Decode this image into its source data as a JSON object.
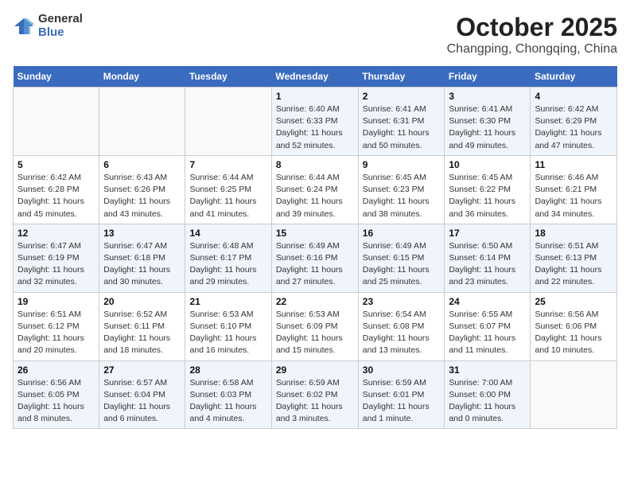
{
  "header": {
    "logo_general": "General",
    "logo_blue": "Blue",
    "title": "October 2025",
    "subtitle": "Changping, Chongqing, China"
  },
  "weekdays": [
    "Sunday",
    "Monday",
    "Tuesday",
    "Wednesday",
    "Thursday",
    "Friday",
    "Saturday"
  ],
  "weeks": [
    [
      {
        "day": "",
        "info": ""
      },
      {
        "day": "",
        "info": ""
      },
      {
        "day": "",
        "info": ""
      },
      {
        "day": "1",
        "info": "Sunrise: 6:40 AM\nSunset: 6:33 PM\nDaylight: 11 hours\nand 52 minutes."
      },
      {
        "day": "2",
        "info": "Sunrise: 6:41 AM\nSunset: 6:31 PM\nDaylight: 11 hours\nand 50 minutes."
      },
      {
        "day": "3",
        "info": "Sunrise: 6:41 AM\nSunset: 6:30 PM\nDaylight: 11 hours\nand 49 minutes."
      },
      {
        "day": "4",
        "info": "Sunrise: 6:42 AM\nSunset: 6:29 PM\nDaylight: 11 hours\nand 47 minutes."
      }
    ],
    [
      {
        "day": "5",
        "info": "Sunrise: 6:42 AM\nSunset: 6:28 PM\nDaylight: 11 hours\nand 45 minutes."
      },
      {
        "day": "6",
        "info": "Sunrise: 6:43 AM\nSunset: 6:26 PM\nDaylight: 11 hours\nand 43 minutes."
      },
      {
        "day": "7",
        "info": "Sunrise: 6:44 AM\nSunset: 6:25 PM\nDaylight: 11 hours\nand 41 minutes."
      },
      {
        "day": "8",
        "info": "Sunrise: 6:44 AM\nSunset: 6:24 PM\nDaylight: 11 hours\nand 39 minutes."
      },
      {
        "day": "9",
        "info": "Sunrise: 6:45 AM\nSunset: 6:23 PM\nDaylight: 11 hours\nand 38 minutes."
      },
      {
        "day": "10",
        "info": "Sunrise: 6:45 AM\nSunset: 6:22 PM\nDaylight: 11 hours\nand 36 minutes."
      },
      {
        "day": "11",
        "info": "Sunrise: 6:46 AM\nSunset: 6:21 PM\nDaylight: 11 hours\nand 34 minutes."
      }
    ],
    [
      {
        "day": "12",
        "info": "Sunrise: 6:47 AM\nSunset: 6:19 PM\nDaylight: 11 hours\nand 32 minutes."
      },
      {
        "day": "13",
        "info": "Sunrise: 6:47 AM\nSunset: 6:18 PM\nDaylight: 11 hours\nand 30 minutes."
      },
      {
        "day": "14",
        "info": "Sunrise: 6:48 AM\nSunset: 6:17 PM\nDaylight: 11 hours\nand 29 minutes."
      },
      {
        "day": "15",
        "info": "Sunrise: 6:49 AM\nSunset: 6:16 PM\nDaylight: 11 hours\nand 27 minutes."
      },
      {
        "day": "16",
        "info": "Sunrise: 6:49 AM\nSunset: 6:15 PM\nDaylight: 11 hours\nand 25 minutes."
      },
      {
        "day": "17",
        "info": "Sunrise: 6:50 AM\nSunset: 6:14 PM\nDaylight: 11 hours\nand 23 minutes."
      },
      {
        "day": "18",
        "info": "Sunrise: 6:51 AM\nSunset: 6:13 PM\nDaylight: 11 hours\nand 22 minutes."
      }
    ],
    [
      {
        "day": "19",
        "info": "Sunrise: 6:51 AM\nSunset: 6:12 PM\nDaylight: 11 hours\nand 20 minutes."
      },
      {
        "day": "20",
        "info": "Sunrise: 6:52 AM\nSunset: 6:11 PM\nDaylight: 11 hours\nand 18 minutes."
      },
      {
        "day": "21",
        "info": "Sunrise: 6:53 AM\nSunset: 6:10 PM\nDaylight: 11 hours\nand 16 minutes."
      },
      {
        "day": "22",
        "info": "Sunrise: 6:53 AM\nSunset: 6:09 PM\nDaylight: 11 hours\nand 15 minutes."
      },
      {
        "day": "23",
        "info": "Sunrise: 6:54 AM\nSunset: 6:08 PM\nDaylight: 11 hours\nand 13 minutes."
      },
      {
        "day": "24",
        "info": "Sunrise: 6:55 AM\nSunset: 6:07 PM\nDaylight: 11 hours\nand 11 minutes."
      },
      {
        "day": "25",
        "info": "Sunrise: 6:56 AM\nSunset: 6:06 PM\nDaylight: 11 hours\nand 10 minutes."
      }
    ],
    [
      {
        "day": "26",
        "info": "Sunrise: 6:56 AM\nSunset: 6:05 PM\nDaylight: 11 hours\nand 8 minutes."
      },
      {
        "day": "27",
        "info": "Sunrise: 6:57 AM\nSunset: 6:04 PM\nDaylight: 11 hours\nand 6 minutes."
      },
      {
        "day": "28",
        "info": "Sunrise: 6:58 AM\nSunset: 6:03 PM\nDaylight: 11 hours\nand 4 minutes."
      },
      {
        "day": "29",
        "info": "Sunrise: 6:59 AM\nSunset: 6:02 PM\nDaylight: 11 hours\nand 3 minutes."
      },
      {
        "day": "30",
        "info": "Sunrise: 6:59 AM\nSunset: 6:01 PM\nDaylight: 11 hours\nand 1 minute."
      },
      {
        "day": "31",
        "info": "Sunrise: 7:00 AM\nSunset: 6:00 PM\nDaylight: 11 hours\nand 0 minutes."
      },
      {
        "day": "",
        "info": ""
      }
    ]
  ]
}
